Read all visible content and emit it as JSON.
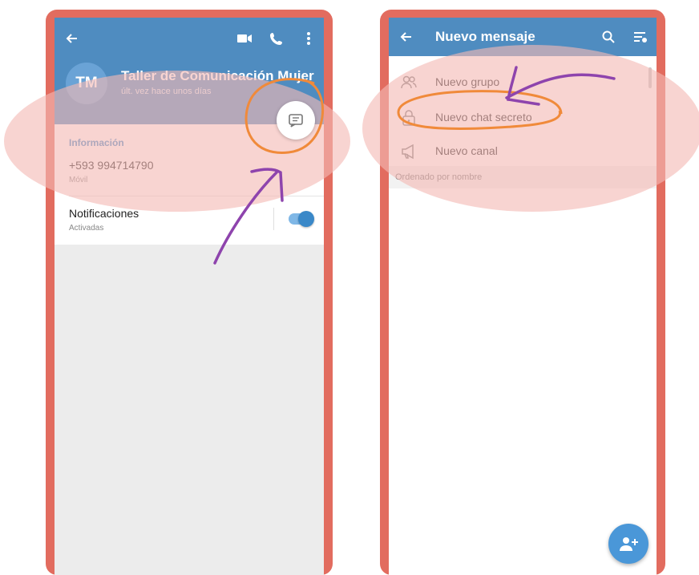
{
  "left_screen": {
    "header": {
      "back_icon": "arrow-left-icon",
      "video_icon": "video-camera-icon",
      "call_icon": "phone-icon",
      "more_icon": "more-vertical-icon",
      "avatar_initials": "TM",
      "contact_name": "Taller de Comunicación Mujer",
      "last_seen": "últ. vez hace unos días",
      "message_button_icon": "message-icon"
    },
    "info": {
      "section_title": "Información",
      "phone_number": "+593 994714790",
      "phone_label": "Móvil",
      "notifications_title": "Notificaciones",
      "notifications_status": "Activadas",
      "notifications_enabled": true
    }
  },
  "right_screen": {
    "header": {
      "back_icon": "arrow-left-icon",
      "title": "Nuevo mensaje",
      "search_icon": "search-icon",
      "sort_icon": "sort-icon"
    },
    "menu": [
      {
        "label": "Nuevo grupo",
        "icon": "group-icon"
      },
      {
        "label": "Nuevo chat secreto",
        "icon": "lock-icon"
      },
      {
        "label": "Nuevo canal",
        "icon": "megaphone-icon"
      }
    ],
    "sort_label": "Ordenado por nombre",
    "fab_icon": "add-contact-icon"
  },
  "colors": {
    "frame": "#e26c5f",
    "header_blue": "#4f8cc0",
    "accent_blue": "#3a88c8",
    "highlight_pink": "#f3b9b4",
    "annotation_orange": "#f08a3a",
    "annotation_purple": "#8e44ad"
  }
}
